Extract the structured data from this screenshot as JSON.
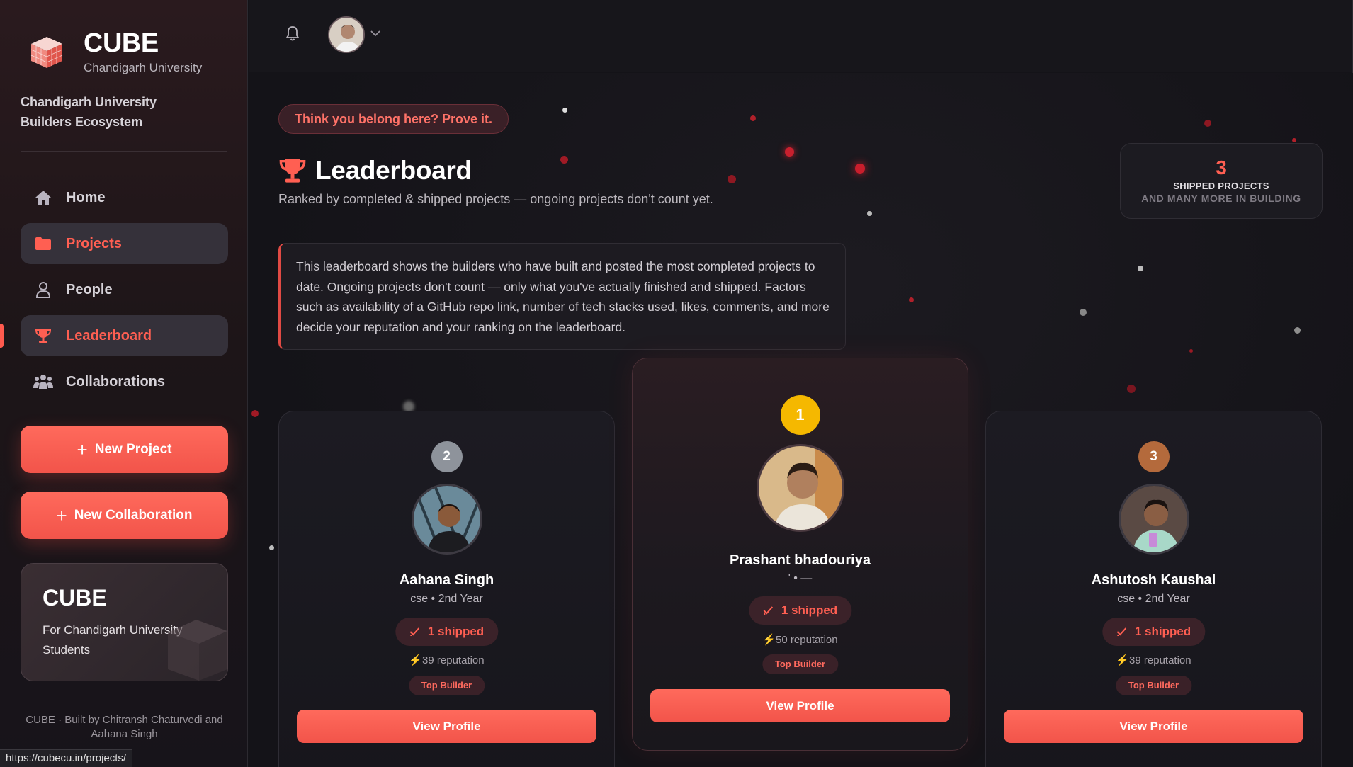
{
  "sidebar": {
    "brand_name": "CUBE",
    "brand_sub": "Chandigarh University",
    "ecosystem": "Chandigarh University Builders Ecosystem",
    "nav": [
      {
        "label": "Home",
        "icon": "home-icon"
      },
      {
        "label": "Projects",
        "icon": "folder-icon"
      },
      {
        "label": "People",
        "icon": "person-icon"
      },
      {
        "label": "Leaderboard",
        "icon": "trophy-icon"
      },
      {
        "label": "Collaborations",
        "icon": "group-icon"
      }
    ],
    "new_project": "New Project",
    "new_collaboration": "New Collaboration",
    "promo_title": "CUBE",
    "promo_sub": "For Chandigarh University Students",
    "footer": "CUBE · Built by Chitransh Chaturvedi and Aahana Singh"
  },
  "status_url": "https://cubecu.in/projects/",
  "main": {
    "tag": "Think you belong here? Prove it.",
    "title": "Leaderboard",
    "subtitle": "Ranked by completed & shipped projects — ongoing projects don't count yet.",
    "stat": {
      "value": "3",
      "line1": "SHIPPED PROJECTS",
      "line2": "AND MANY MORE IN BUILDING"
    },
    "info": "This leaderboard shows the builders who have built and posted the most completed projects to date. Ongoing projects don't count — only what you've actually finished and shipped. Factors such as availability of a GitHub repo link, number of tech stacks used, likes, comments, and more decide your reputation and your ranking on the leaderboard."
  },
  "cards": [
    {
      "rank": "2",
      "name": "Aahana Singh",
      "meta": "cse • 2nd Year",
      "shipped": "1 shipped",
      "reputation": "39 reputation",
      "badge": "Top Builder",
      "button": "View Profile"
    },
    {
      "rank": "1",
      "name": "Prashant bhadouriya",
      "meta": "' • —",
      "shipped": "1 shipped",
      "reputation": "50 reputation",
      "badge": "Top Builder",
      "button": "View Profile"
    },
    {
      "rank": "3",
      "name": "Ashutosh Kaushal",
      "meta": "cse • 2nd Year",
      "shipped": "1 shipped",
      "reputation": "39 reputation",
      "badge": "Top Builder",
      "button": "View Profile"
    }
  ],
  "colors": {
    "accent": "#ff5f52",
    "gold": "#f5b800",
    "silver": "#8e939b",
    "bronze": "#b46a3c"
  }
}
